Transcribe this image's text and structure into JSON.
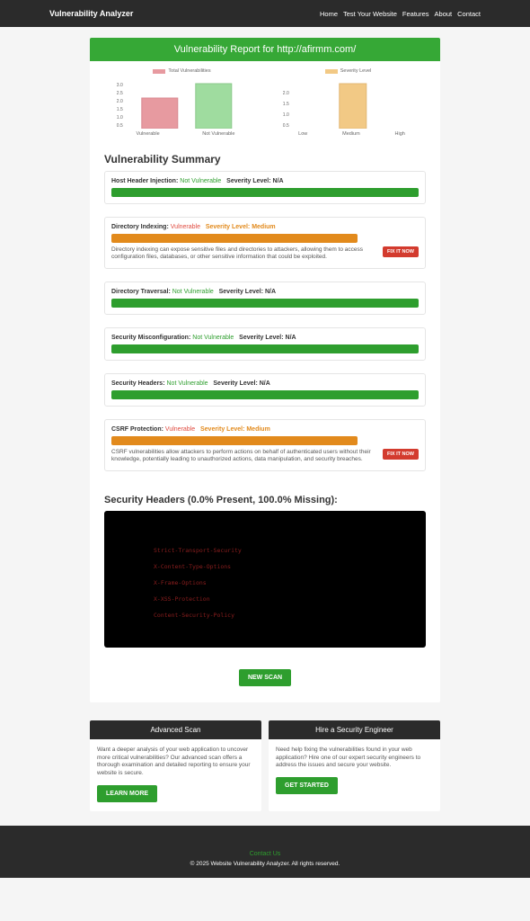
{
  "nav": {
    "brand": "Vulnerability Analyzer",
    "links": [
      "Home",
      "Test Your Website",
      "Features",
      "About",
      "Contact"
    ]
  },
  "report_title": "Vulnerability Report for http://afirmm.com/",
  "chart_data": [
    {
      "type": "bar",
      "legend": "Total Vulnerabilities",
      "legend_color": "#e79aa0",
      "categories": [
        "Vulnerable",
        "Not Vulnerable"
      ],
      "series": [
        {
          "name": "Total Vulnerabilities",
          "values": [
            2,
            3
          ],
          "colors": [
            "#e79aa0",
            "#9fdc9f"
          ]
        }
      ],
      "yticks": [
        0.5,
        1.0,
        1.5,
        2.0,
        2.5,
        3.0
      ],
      "ylim": [
        0,
        3
      ]
    },
    {
      "type": "bar",
      "legend": "Severity Level",
      "legend_color": "#f2c985",
      "categories": [
        "Low",
        "Medium",
        "High"
      ],
      "series": [
        {
          "name": "Severity Level",
          "values": [
            0,
            2,
            0
          ],
          "colors": [
            "#f2c985",
            "#f2c985",
            "#f2c985"
          ]
        }
      ],
      "yticks": [
        0.5,
        1.0,
        1.5,
        2.0
      ],
      "ylim": [
        0,
        2
      ]
    }
  ],
  "summary_title": "Vulnerability Summary",
  "items": [
    {
      "name": "Host Header Injection",
      "status": "Not Vulnerable",
      "status_class": "status-notvuln",
      "sev": "Severity Level: N/A",
      "bar": "green",
      "desc": null
    },
    {
      "name": "Directory Indexing",
      "status": "Vulnerable",
      "status_class": "status-vuln",
      "sev_label": "Severity Level: Medium",
      "sev_class": "sev-orange",
      "bar": "orange",
      "desc": "Directory indexing can expose sensitive files and directories to attackers, allowing them to access configuration files, databases, or other sensitive information that could be exploited.",
      "fix": "FIX IT NOW"
    },
    {
      "name": "Directory Traversal",
      "status": "Not Vulnerable",
      "status_class": "status-notvuln",
      "sev": "Severity Level: N/A",
      "bar": "green",
      "desc": null
    },
    {
      "name": "Security Misconfiguration",
      "status": "Not Vulnerable",
      "status_class": "status-notvuln",
      "sev": "Severity Level: N/A",
      "bar": "green",
      "desc": null
    },
    {
      "name": "Security Headers",
      "status": "Not Vulnerable",
      "status_class": "status-notvuln",
      "sev": "Severity Level: N/A",
      "bar": "green",
      "desc": null
    },
    {
      "name": "CSRF Protection",
      "status": "Vulnerable",
      "status_class": "status-vuln",
      "sev_label": "Severity Level: Medium",
      "sev_class": "sev-orange",
      "bar": "orange",
      "desc": "CSRF vulnerabilities allow attackers to perform actions on behalf of authenticated users without their knowledge, potentially leading to unauthorized actions, data manipulation, and security breaches.",
      "fix": "FIX IT NOW"
    }
  ],
  "headers_title": "Security Headers (0.0% Present, 100.0% Missing):",
  "headers_list": [
    "Strict-Transport-Security",
    "X-Content-Type-Options",
    "X-Frame-Options",
    "X-XSS-Protection",
    "Content-Security-Policy"
  ],
  "new_scan": "NEW SCAN",
  "promos": [
    {
      "title": "Advanced Scan",
      "body": "Want a deeper analysis of your web application to uncover more critical vulnerabilities? Our advanced scan offers a thorough examination and detailed reporting to ensure your website is secure.",
      "cta": "LEARN MORE"
    },
    {
      "title": "Hire a Security Engineer",
      "body": "Need help fixing the vulnerabilities found in your web application? Hire one of our expert security engineers to address the issues and secure your website.",
      "cta": "GET STARTED"
    }
  ],
  "footer": {
    "contact": "Contact Us",
    "copy": "© 2025 Website Vulnerability Analyzer. All rights reserved."
  }
}
